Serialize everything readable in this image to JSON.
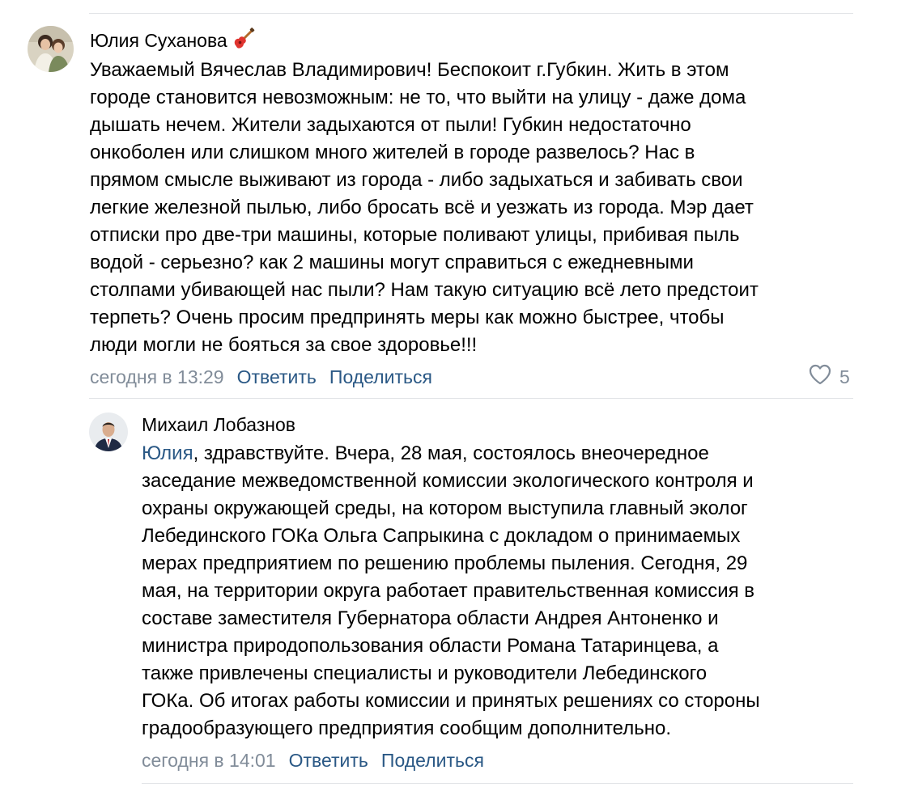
{
  "colors": {
    "link": "#2a5885",
    "meta": "#818c99",
    "divider": "#e1e3e6",
    "heart": "#818c99"
  },
  "comments": [
    {
      "author": "Юлия Суханова",
      "author_emoji_icon": "guitar-icon",
      "text_lines": [
        "Уважаемый Вячеслав Владимирович! Беспокоит г.Губкин. Жить в этом",
        "городе становится невозможным: не то, что выйти на улицу - даже дома",
        "дышать нечем. Жители задыхаются от пыли! Губкин недостаточно",
        "онкоболен или слишком много жителей в городе развелось? Нас в",
        "прямом смысле выживают из города - либо задыхаться и забивать свои",
        "легкие железной пылью, либо бросать всё и уезжать из города. Мэр дает",
        "отписки про две-три машины, которые поливают улицы, прибивая пыль",
        "водой - серьезно? как 2 машины могут справиться с ежедневными",
        "столпами убивающей нас пыли? Нам такую ситуацию всё лето предстоит",
        "терпеть? Очень просим предпринять меры как можно быстрее, чтобы",
        "люди могли не бояться за свое здоровье!!!"
      ],
      "date": "сегодня в 13:29",
      "reply_label": "Ответить",
      "share_label": "Поделиться",
      "likes": "5"
    },
    {
      "author": "Михаил Лобазнов",
      "mention": "Юлия",
      "first_line_rest": ", здравствуйте. Вчера, 28 мая, состоялось внеочередное",
      "text_lines": [
        "заседание межведомственной комиссии экологического контроля и",
        "охраны окружающей среды, на котором выступила главный эколог",
        "Лебединского ГОКа Ольга Сапрыкина с докладом о принимаемых",
        "мерах предприятием по решению проблемы пыления. Сегодня, 29",
        "мая, на территории округа работает правительственная комиссия в",
        "составе заместителя Губернатора области Андрея Антоненко и",
        "министра природопользования области Романа Татаринцева, а",
        "также привлечены специалисты и руководители Лебединского",
        "ГОКа. Об итогах работы комиссии и принятых решениях со стороны",
        "градообразующего предприятия сообщим дополнительно."
      ],
      "date": "сегодня в 14:01",
      "reply_label": "Ответить",
      "share_label": "Поделиться"
    }
  ]
}
